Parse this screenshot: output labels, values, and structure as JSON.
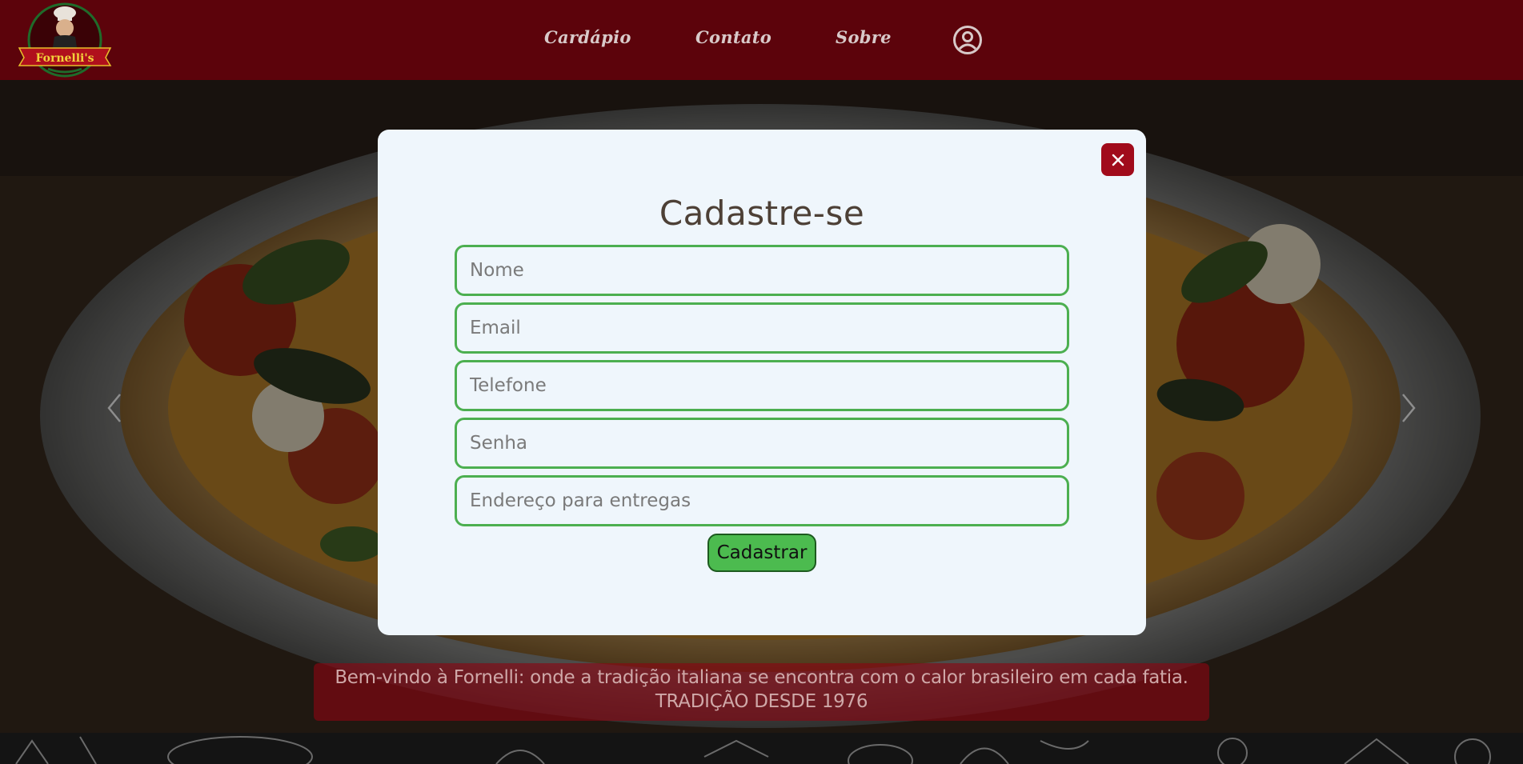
{
  "header": {
    "logo_text": "Fornelli's",
    "nav": {
      "cardapio": "Cardápio",
      "contato": "Contato",
      "sobre": "Sobre"
    }
  },
  "hero": {
    "caption_line1": "Bem-vindo à Fornelli: onde a tradição italiana se encontra com o calor brasileiro em cada fatia.",
    "caption_line2": "TRADIÇÃO DESDE 1976"
  },
  "modal": {
    "title": "Cadastre-se",
    "fields": {
      "nome": "Nome",
      "email": "Email",
      "telefone": "Telefone",
      "senha": "Senha",
      "endereco": "Endereço para entregas"
    },
    "submit_label": "Cadastrar"
  },
  "colors": {
    "header_bg": "#5c030b",
    "accent_green": "#4caf50",
    "close_red": "#a10b1b",
    "modal_bg": "#eff6fc"
  },
  "icons": [
    "chef-logo",
    "user-circle-icon",
    "chevron-left-icon",
    "chevron-right-icon",
    "close-icon"
  ]
}
